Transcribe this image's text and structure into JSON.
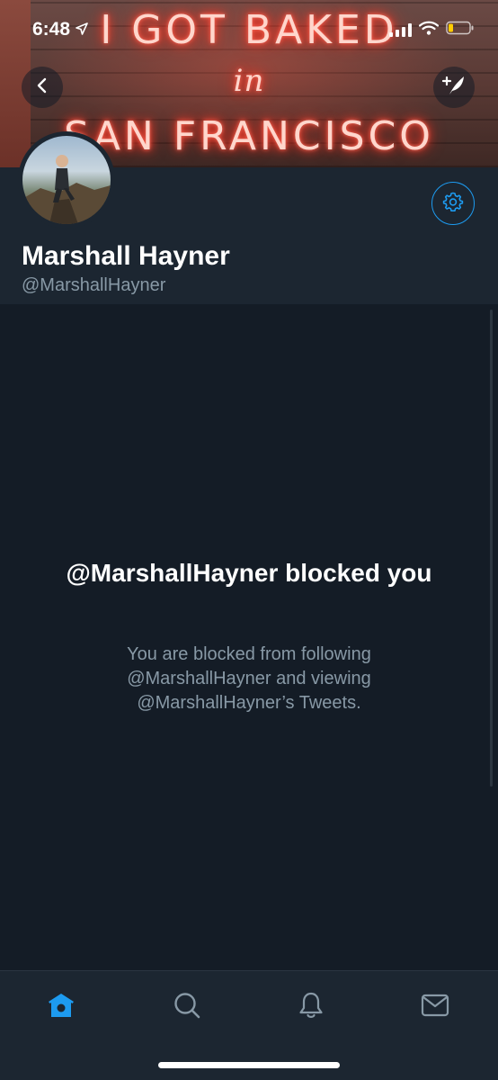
{
  "status_bar": {
    "time": "6:48",
    "location_icon": "location-arrow-icon",
    "signal_icon": "cellular-signal-icon",
    "wifi_icon": "wifi-icon",
    "battery_icon": "battery-low-icon"
  },
  "banner": {
    "sign_line1": "I GOT BAKED",
    "sign_line2": "in",
    "sign_line3": "SAN FRANCISCO"
  },
  "header": {
    "back_icon": "chevron-left-icon",
    "compose_icon": "compose-tweet-icon",
    "settings_icon": "gear-icon"
  },
  "profile": {
    "name": "Marshall Hayner",
    "handle": "@MarshallHayner"
  },
  "blocked": {
    "title": "@MarshallHayner blocked you",
    "message": "You are blocked from following @MarshallHayner and viewing @MarshallHayner’s Tweets."
  },
  "tab_bar": {
    "tabs": [
      {
        "name": "home",
        "icon": "home-icon",
        "active": true
      },
      {
        "name": "search",
        "icon": "search-icon",
        "active": false
      },
      {
        "name": "notifications",
        "icon": "bell-icon",
        "active": false
      },
      {
        "name": "messages",
        "icon": "envelope-icon",
        "active": false
      }
    ]
  },
  "colors": {
    "accent": "#1d9bf0",
    "background": "#141c26",
    "surface": "#1c2631",
    "secondary_text": "#8899a6"
  }
}
